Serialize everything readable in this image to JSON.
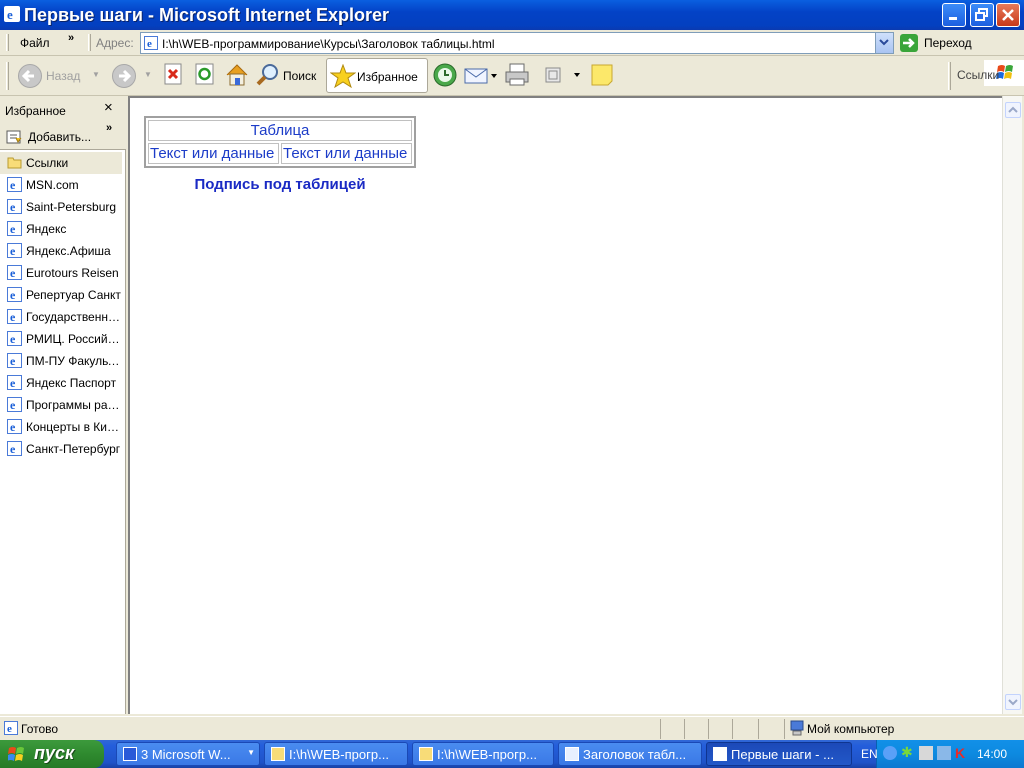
{
  "window": {
    "title": "Первые шаги - Microsoft Internet Explorer"
  },
  "menu": {
    "file": "Файл",
    "chevron": "»"
  },
  "address": {
    "label": "Адрес:",
    "value": "I:\\h\\WEB-программирование\\Курсы\\Заголовок таблицы.html",
    "go_label": "Переход"
  },
  "toolbar": {
    "back": "Назад",
    "search": "Поиск",
    "favorites": "Избранное",
    "links": "Ссылки"
  },
  "favorites_pane": {
    "title": "Избранное",
    "close": "×",
    "add": "Добавить...",
    "chevron": "»",
    "items": [
      {
        "label": "Ссылки",
        "icon": "folder-icon"
      },
      {
        "label": "MSN.com",
        "icon": "ie-page-icon"
      },
      {
        "label": "Saint-Petersburg",
        "icon": "ie-page-icon"
      },
      {
        "label": "Яндекс",
        "icon": "ie-page-icon"
      },
      {
        "label": "Яндекс.Афиша",
        "icon": "ie-page-icon"
      },
      {
        "label": "Eurotours Reisen",
        "icon": "ie-page-icon"
      },
      {
        "label": "Репертуар Санкт",
        "icon": "ie-page-icon"
      },
      {
        "label": "Государственный",
        "icon": "ie-page-icon"
      },
      {
        "label": "РМИЦ. Российский",
        "icon": "ie-page-icon"
      },
      {
        "label": "ПМ-ПУ  Факультет",
        "icon": "ie-page-icon"
      },
      {
        "label": "Яндекс Паспорт",
        "icon": "ie-page-icon"
      },
      {
        "label": "Программы радио",
        "icon": "ie-page-icon"
      },
      {
        "label": "Концерты в Киеве",
        "icon": "ie-page-icon"
      },
      {
        "label": "Санкт-Петербург",
        "icon": "ie-page-icon"
      }
    ]
  },
  "page": {
    "table": {
      "header": "Таблица",
      "row": [
        "Текст или данные",
        "Текст или данные"
      ]
    },
    "caption": "Подпись под таблицей"
  },
  "status": {
    "text": "Готово",
    "zone": "Мой компьютер"
  },
  "taskbar": {
    "start": "пуск",
    "tasks": [
      {
        "label": "3 Microsoft W...",
        "icon": "word-icon"
      },
      {
        "label": "I:\\h\\WEB-прогр...",
        "icon": "folder-icon"
      },
      {
        "label": "I:\\h\\WEB-прогр...",
        "icon": "folder-icon"
      },
      {
        "label": "Заголовок табл...",
        "icon": "notepad-icon"
      },
      {
        "label": "Первые шаги - ...",
        "icon": "ie-icon"
      }
    ],
    "lang": "EN",
    "clock": "14:00"
  }
}
